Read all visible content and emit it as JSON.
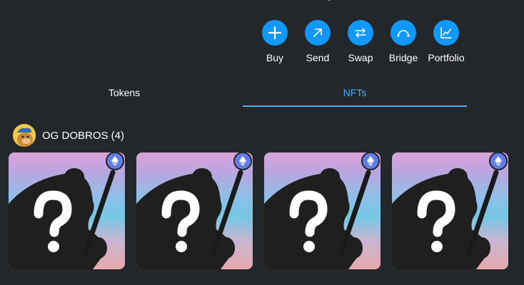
{
  "actions": [
    {
      "label": "Buy",
      "icon": "plus-icon"
    },
    {
      "label": "Send",
      "icon": "arrow-up-right-icon"
    },
    {
      "label": "Swap",
      "icon": "swap-arrows-icon"
    },
    {
      "label": "Bridge",
      "icon": "bridge-icon"
    },
    {
      "label": "Portfolio",
      "icon": "chart-icon"
    }
  ],
  "tabs": [
    {
      "label": "Tokens",
      "active": false
    },
    {
      "label": "NFTs",
      "active": true
    }
  ],
  "collection": {
    "name": "OG DOBROS (4)",
    "avatar_icon": "dog-avatar-icon",
    "items": [
      {
        "network_icon": "ethereum-icon"
      },
      {
        "network_icon": "ethereum-icon"
      },
      {
        "network_icon": "ethereum-icon"
      },
      {
        "network_icon": "ethereum-icon"
      }
    ]
  },
  "colors": {
    "background": "#24272a",
    "accent": "#1098fc",
    "active_tab": "#43aefc",
    "eth_badge": "#627eea"
  }
}
